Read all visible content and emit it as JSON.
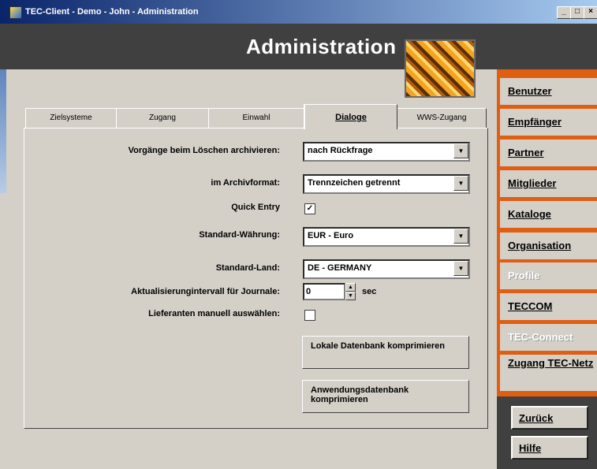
{
  "window": {
    "title": "TEC-Client - Demo - John - Administration",
    "controls": [
      "_",
      "□",
      "×"
    ]
  },
  "header": {
    "title": "Administration"
  },
  "tabs": [
    "Zielsysteme",
    "Zugang",
    "Einwahl",
    "Dialoge",
    "WWS-Zugang"
  ],
  "active_tab": "Dialoge",
  "form": {
    "archive_label": "Vorgänge beim Löschen archivieren:",
    "archive_value": "nach Rückfrage",
    "format_label": "im Archivformat:",
    "format_value": "Trennzeichen getrennt",
    "quickentry_label": "Quick Entry",
    "quickentry_checked": true,
    "currency_label": "Standard-Währung:",
    "currency_value": "EUR - Euro",
    "country_label": "Standard-Land:",
    "country_value": "DE - GERMANY",
    "interval_label": "Aktualisierungintervall für Journale:",
    "interval_value": "0",
    "interval_unit": "sec",
    "supplier_label": "Lieferanten manuell auswählen:",
    "supplier_checked": false,
    "btn_local_db": "Lokale Datenbank komprimieren",
    "btn_app_db": "Anwendungsdatenbank komprimieren"
  },
  "sidebar": [
    {
      "label": "Benutzer",
      "enabled": true
    },
    {
      "label": "Empfänger",
      "enabled": true
    },
    {
      "label": "Partner",
      "enabled": true
    },
    {
      "label": "Mitglieder",
      "enabled": true
    },
    {
      "label": "Kataloge",
      "enabled": true
    },
    {
      "label": "Organisation",
      "enabled": true
    },
    {
      "label": "Profile",
      "enabled": false
    },
    {
      "label": "TECCOM",
      "enabled": true
    },
    {
      "label": "TEC-Connect",
      "enabled": false
    },
    {
      "label": "Zugang TEC-Netz",
      "enabled": true
    }
  ],
  "footer": {
    "back": "Zurück",
    "help": "Hilfe"
  },
  "colors": {
    "accent": "#e05e12",
    "dark": "#404040",
    "face": "#d4d0c8"
  }
}
